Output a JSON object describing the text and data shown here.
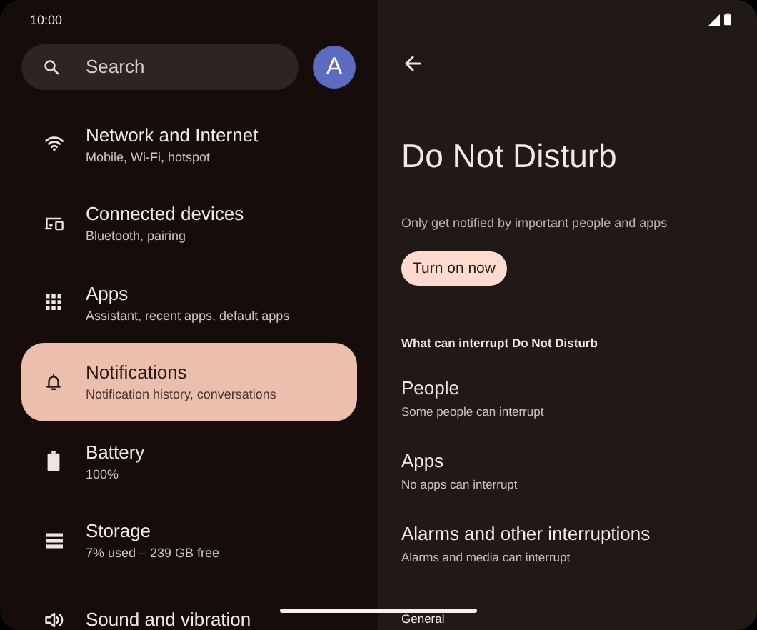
{
  "status_bar": {
    "time": "10:00"
  },
  "search": {
    "placeholder": "Search"
  },
  "avatar": {
    "initial": "A"
  },
  "menu": [
    {
      "title": "Network and Internet",
      "subtitle": "Mobile, Wi-Fi, hotspot",
      "selected": false
    },
    {
      "title": "Connected devices",
      "subtitle": "Bluetooth, pairing",
      "selected": false
    },
    {
      "title": "Apps",
      "subtitle": "Assistant, recent apps, default apps",
      "selected": false
    },
    {
      "title": "Notifications",
      "subtitle": "Notification history, conversations",
      "selected": true
    },
    {
      "title": "Battery",
      "subtitle": "100%",
      "selected": false
    },
    {
      "title": "Storage",
      "subtitle": "7% used – 239 GB free",
      "selected": false
    },
    {
      "title": "Sound and vibration",
      "selected": false
    }
  ],
  "detail": {
    "title": "Do Not Disturb",
    "description": "Only get notified by important people and apps",
    "button": "Turn on now",
    "section_header": "What can interrupt Do Not Disturb",
    "items": [
      {
        "title": "People",
        "subtitle": "Some people can interrupt"
      },
      {
        "title": "Apps",
        "subtitle": "No apps can interrupt"
      },
      {
        "title": "Alarms and other interruptions",
        "subtitle": "Alarms and media can interrupt"
      }
    ],
    "next_section_header": "General"
  }
}
